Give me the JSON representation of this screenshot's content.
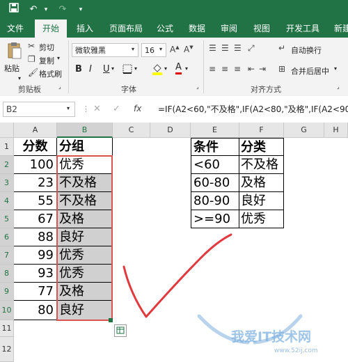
{
  "quick_access": {
    "save_icon": "save-icon",
    "undo_icon": "undo-icon",
    "redo_icon": "redo-icon"
  },
  "tabs": [
    "文件",
    "开始",
    "插入",
    "页面布局",
    "公式",
    "数据",
    "审阅",
    "视图",
    "开发工具",
    "新建"
  ],
  "active_tab": "开始",
  "ribbon": {
    "paste": "粘贴",
    "cut": "剪切",
    "copy": "复制",
    "format_painter": "格式刷",
    "clipboard_group": "剪贴板",
    "font_name": "微软雅黑",
    "font_size": "16",
    "bold": "B",
    "italic": "I",
    "underline": "U",
    "font_color_letter": "A",
    "font_group": "字体",
    "wrap_text": "自动换行",
    "merge_center": "合并后居中",
    "alignment_group": "对齐方式"
  },
  "formula_bar": {
    "name_box": "B2",
    "fx": "fx",
    "formula": "=IF(A2<60,\"不及格\",IF(A2<80,\"及格\",IF(A2<90,\"良"
  },
  "columns": [
    "A",
    "B",
    "C",
    "D",
    "E",
    "F",
    "G",
    "H"
  ],
  "rows": [
    "1",
    "2",
    "3",
    "4",
    "5",
    "6",
    "7",
    "8",
    "9",
    "10",
    "11",
    "12"
  ],
  "table": {
    "header_score": "分数",
    "header_group": "分组",
    "scores": [
      "100",
      "23",
      "55",
      "67",
      "88",
      "99",
      "93",
      "77",
      "80"
    ],
    "groups": [
      "优秀",
      "不及格",
      "不及格",
      "及格",
      "良好",
      "优秀",
      "优秀",
      "及格",
      "良好"
    ]
  },
  "lookup": {
    "header_condition": "条件",
    "header_category": "分类",
    "conditions": [
      "<60",
      "60-80",
      "80-90",
      ">=90"
    ],
    "categories": [
      "不及格",
      "及格",
      "良好",
      "优秀"
    ]
  },
  "colors": {
    "excel_green": "#217346",
    "selection_outline": "#d9534f",
    "checkmark": "#e0393e"
  }
}
